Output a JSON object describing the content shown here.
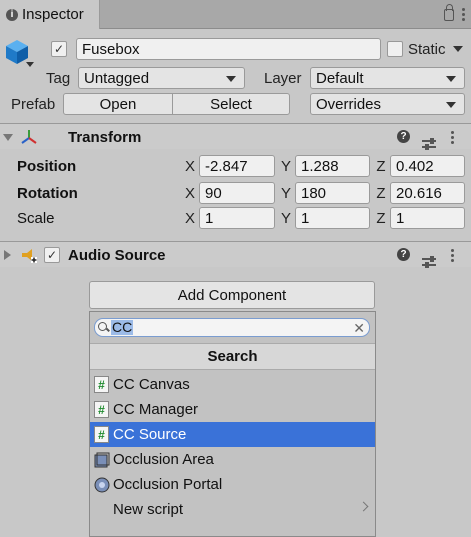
{
  "tab": {
    "title": "Inspector"
  },
  "object": {
    "name": "Fusebox",
    "active": true,
    "static_label": "Static",
    "static_checked": false,
    "tag_label": "Tag",
    "tag_value": "Untagged",
    "layer_label": "Layer",
    "layer_value": "Default",
    "prefab_label": "Prefab",
    "prefab_open": "Open",
    "prefab_select": "Select",
    "prefab_overrides": "Overrides"
  },
  "transform": {
    "title": "Transform",
    "rows": [
      {
        "label": "Position",
        "x": "-2.847",
        "y": "1.288",
        "z": "0.402"
      },
      {
        "label": "Rotation",
        "x": "90",
        "y": "180",
        "z": "20.616"
      },
      {
        "label": "Scale",
        "x": "1",
        "y": "1",
        "z": "1"
      }
    ],
    "axis_x": "X",
    "axis_y": "Y",
    "axis_z": "Z"
  },
  "audio_source": {
    "title": "Audio Source",
    "enabled": true
  },
  "add_component": {
    "button_label": "Add Component",
    "search_value": "CC",
    "section_title": "Search",
    "items": [
      {
        "label": "CC Canvas",
        "icon": "script-icon"
      },
      {
        "label": "CC Manager",
        "icon": "script-icon"
      },
      {
        "label": "CC Source",
        "icon": "script-icon",
        "selected": true
      },
      {
        "label": "Occlusion Area",
        "icon": "occlusion-area-icon"
      },
      {
        "label": "Occlusion Portal",
        "icon": "occlusion-portal-icon"
      },
      {
        "label": "New script",
        "icon": "none"
      }
    ]
  },
  "colors": {
    "selection": "#3a72d8",
    "background": "#c8c8c8"
  }
}
